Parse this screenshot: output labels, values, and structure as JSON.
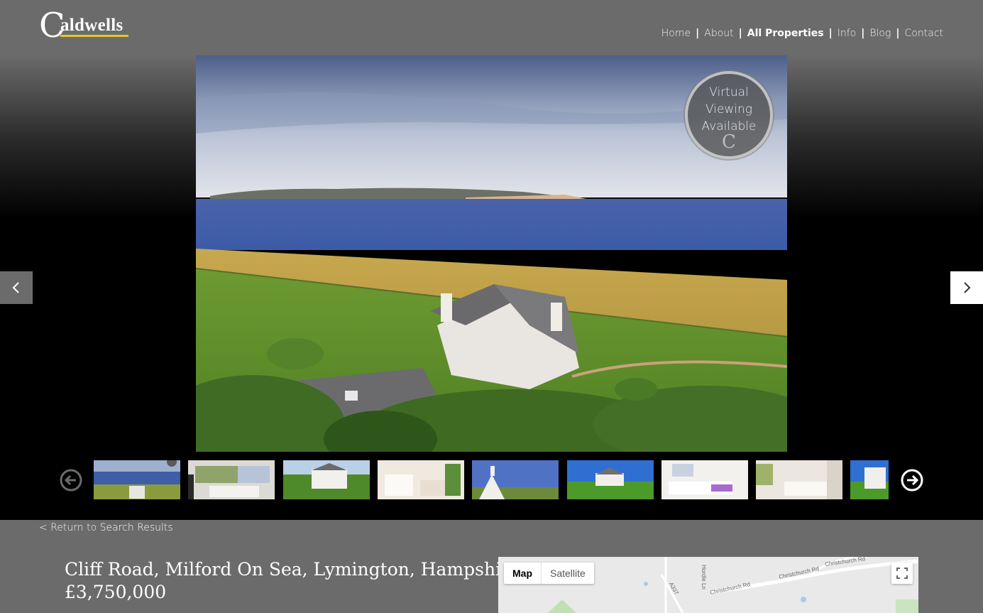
{
  "brand": {
    "logo_initial": "C",
    "logo_rest": "aldwells",
    "accent_color": "#e3c52b"
  },
  "nav": {
    "items": [
      {
        "label": "Home",
        "active": false
      },
      {
        "label": "About",
        "active": false
      },
      {
        "label": "All Properties",
        "active": true
      },
      {
        "label": "Info",
        "active": false
      },
      {
        "label": "Blog",
        "active": false
      },
      {
        "label": "Contact",
        "active": false
      }
    ],
    "separator": "|"
  },
  "gallery": {
    "badge": {
      "line1": "Virtual",
      "line2": "Viewing",
      "line3": "Available",
      "mark": "C"
    },
    "prev_icon": "chevron-left-icon",
    "next_icon": "chevron-right-icon",
    "strip_prev_icon": "circle-arrow-left-icon",
    "strip_next_icon": "circle-arrow-right-icon",
    "thumbnail_count": 9
  },
  "return_link": {
    "prefix": "< Return to ",
    "label": "Search Results"
  },
  "property": {
    "title": "Cliff Road, Milford On Sea, Lymington, Hampshire",
    "price": "£3,750,000"
  },
  "map": {
    "tabs": [
      {
        "label": "Map",
        "active": true
      },
      {
        "label": "Satellite",
        "active": false
      }
    ],
    "fullscreen_icon": "fullscreen-icon",
    "road_labels": [
      "Christchurch Rd",
      "Christchurch Rd",
      "Christchurch Rd",
      "Hordle Ln",
      "A337"
    ]
  }
}
